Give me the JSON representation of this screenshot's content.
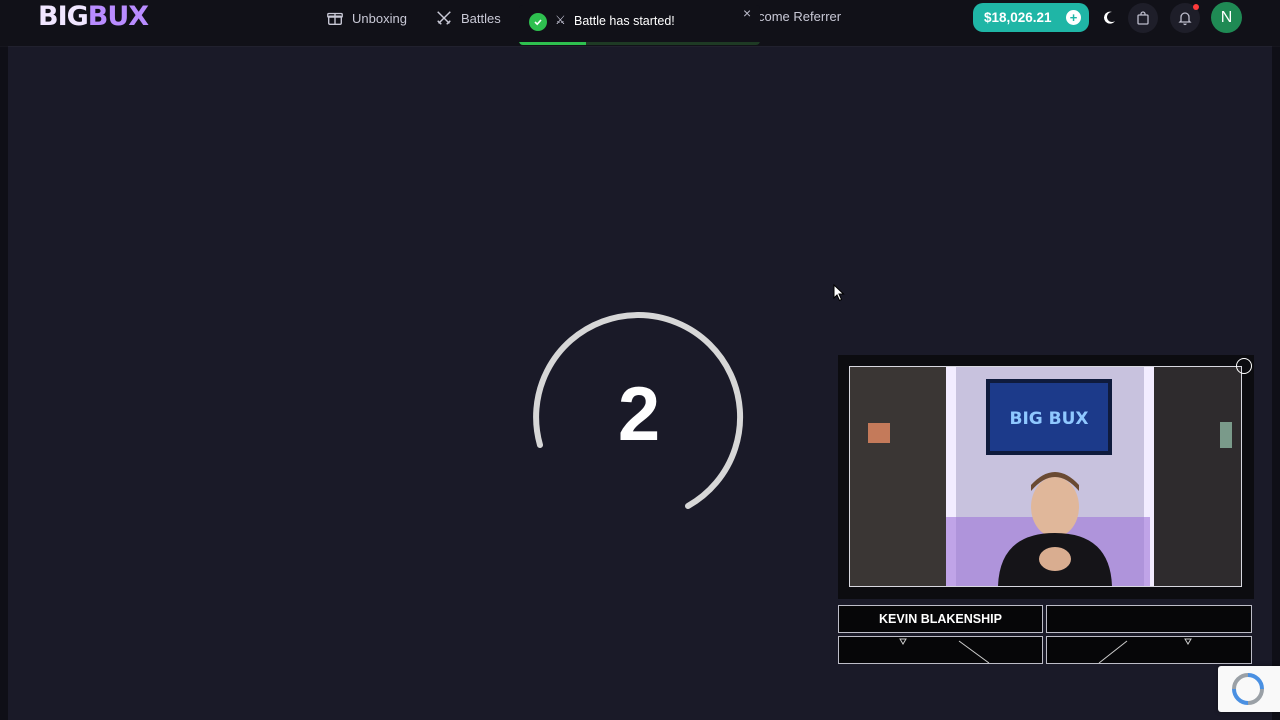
{
  "header": {
    "logo_big": "BIG",
    "logo_bux": "BUX",
    "nav": [
      {
        "label": "Unboxing",
        "icon": "gift-box-icon"
      },
      {
        "label": "Battles",
        "icon": "crossed-swords-icon"
      },
      {
        "label": "come Referrer",
        "icon": ""
      }
    ],
    "balance": "$18,026.21",
    "balance_plus": "+",
    "avatar_letter": "N"
  },
  "toast": {
    "message": "Battle has started!",
    "close": "×",
    "progress": 0.28,
    "color": "#2ec04f"
  },
  "countdown": {
    "value": "2"
  },
  "webcam": {
    "streamer_name": "KEVIN BLAKENSHIP",
    "screen_text": "BIG BUX"
  },
  "colors": {
    "background": "#1a1a28",
    "accent": "#1fb6a6",
    "avatar": "#1f8a54",
    "logo_purple": "#b98cff"
  }
}
